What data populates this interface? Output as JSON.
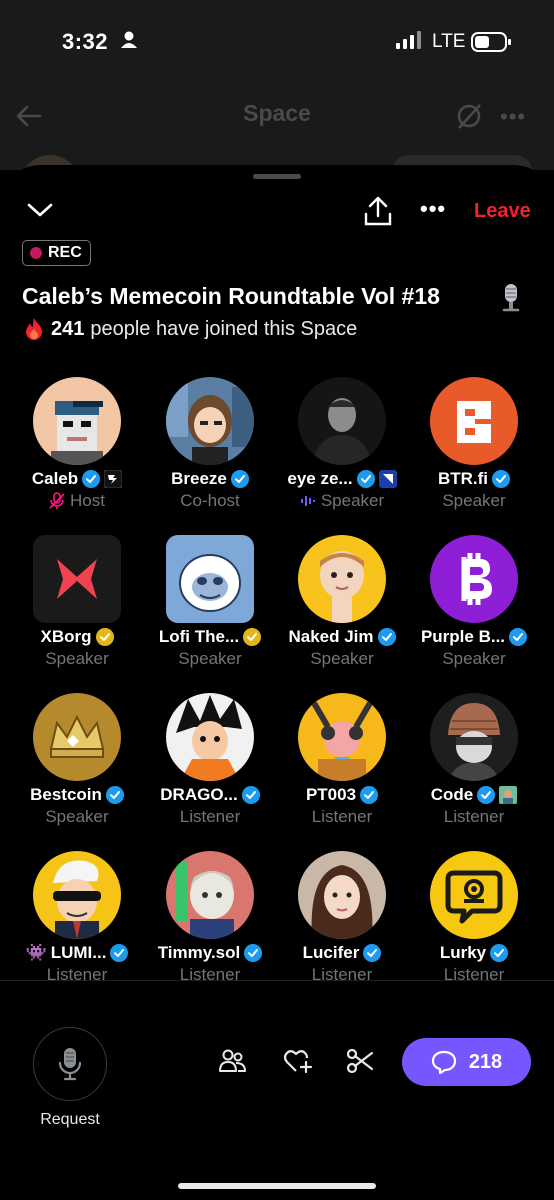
{
  "status_bar": {
    "time": "3:32",
    "network": "LTE"
  },
  "background": {
    "title": "Space"
  },
  "header": {
    "leave_label": "Leave"
  },
  "recording": {
    "label": "REC"
  },
  "space": {
    "title": "Caleb’s Memecoin Roundtable Vol #18",
    "joined_count": "241",
    "joined_text": "people have joined this Space"
  },
  "participants": [
    {
      "name": "Caleb",
      "role": "Host",
      "verified": "blue",
      "extra_badge": "R"
    },
    {
      "name": "Breeze",
      "role": "Co-host",
      "verified": "blue"
    },
    {
      "name": "eye ze...",
      "role": "Speaker",
      "verified": "blue",
      "extra_badge": "sq"
    },
    {
      "name": "BTR.fi",
      "role": "Speaker",
      "verified": "blue"
    },
    {
      "name": "XBorg",
      "role": "Speaker",
      "verified": "gold"
    },
    {
      "name": "Lofi The...",
      "role": "Speaker",
      "verified": "gold"
    },
    {
      "name": "Naked Jim",
      "role": "Speaker",
      "verified": "blue"
    },
    {
      "name": "Purple B...",
      "role": "Speaker",
      "verified": "blue"
    },
    {
      "name": "Bestcoin",
      "role": "Speaker",
      "verified": "blue"
    },
    {
      "name": "DRAGO...",
      "role": "Listener",
      "verified": "blue"
    },
    {
      "name": "PT003",
      "role": "Listener",
      "verified": "blue"
    },
    {
      "name": "Code",
      "role": "Listener",
      "verified": "blue",
      "extra_badge": "img"
    },
    {
      "name": "LUMI...",
      "role": "Listener",
      "verified": "blue",
      "prefix": "👾"
    },
    {
      "name": "Timmy.sol",
      "role": "Listener",
      "verified": "blue"
    },
    {
      "name": "Lucifer",
      "role": "Listener",
      "verified": "blue"
    },
    {
      "name": "Lurky",
      "role": "Listener",
      "verified": "blue"
    }
  ],
  "bottom_bar": {
    "request_label": "Request",
    "comment_count": "218"
  },
  "colors": {
    "accent": "#7856ff",
    "leave": "#f4212e",
    "rec_dot": "#c51960",
    "verified_blue": "#1d9bf0",
    "verified_gold": "#e2b719",
    "muted_text": "#71767b"
  }
}
